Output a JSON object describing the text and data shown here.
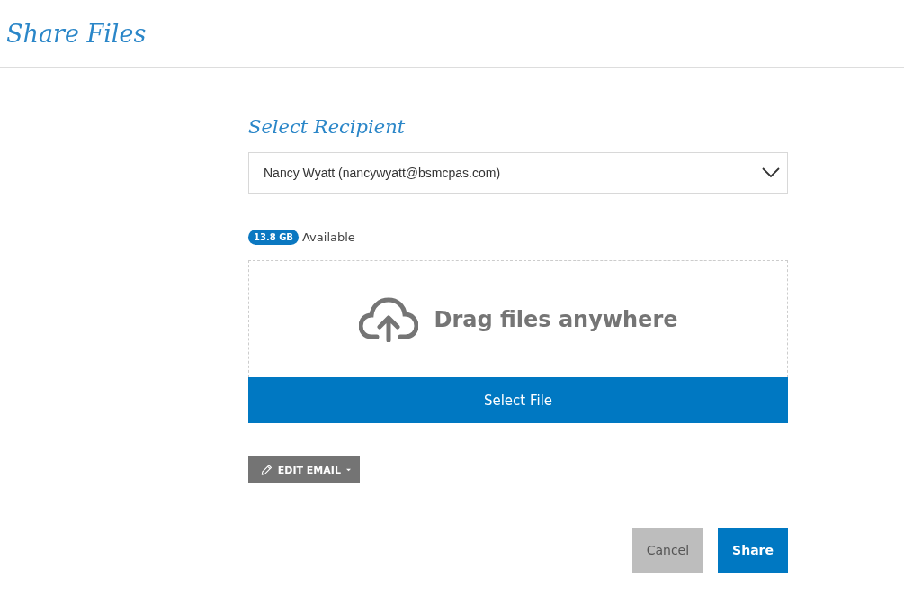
{
  "page": {
    "title": "Share Files"
  },
  "recipient": {
    "heading": "Select Recipient",
    "value": "Nancy Wyatt (nancywyatt@bsmcpas.com)"
  },
  "storage": {
    "badge": "13.8 GB",
    "label": "Available"
  },
  "dropzone": {
    "text": "Drag files anywhere",
    "button": "Select File"
  },
  "edit_email": {
    "label": "EDIT EMAIL"
  },
  "buttons": [
    {
      "label": "Cancel",
      "kind": "secondary"
    },
    {
      "label": "Share",
      "kind": "primary"
    }
  ]
}
